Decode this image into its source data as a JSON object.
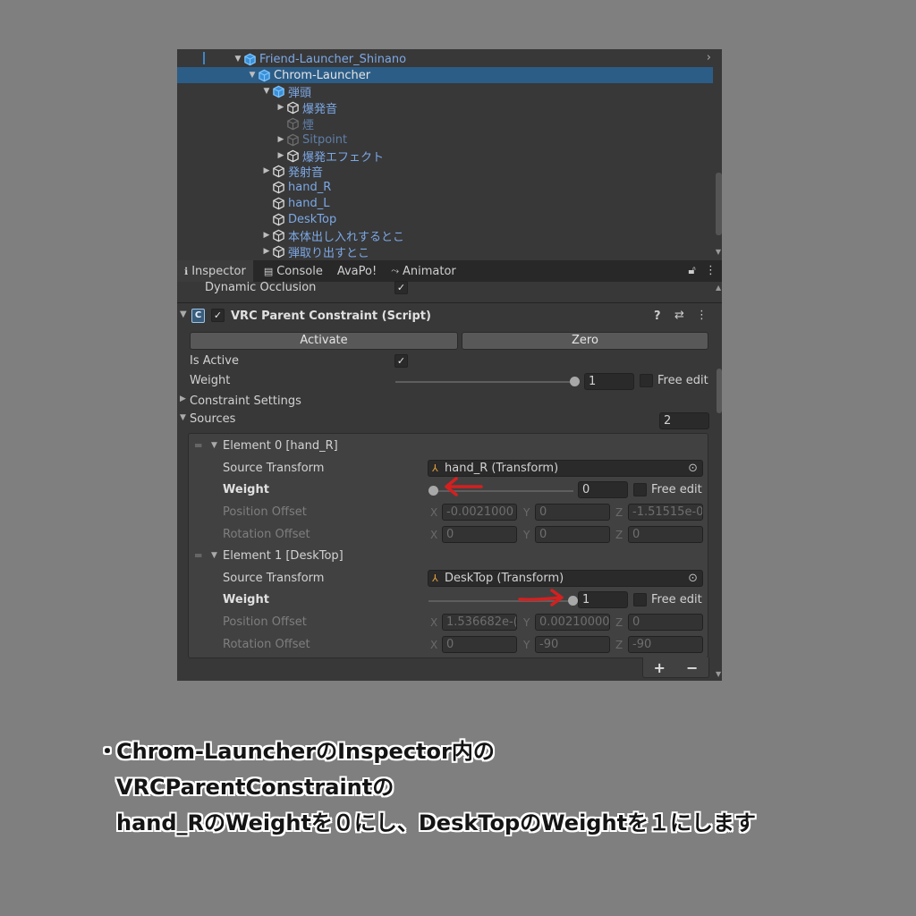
{
  "hierarchy": {
    "items": [
      {
        "label": "Friend-Launcher_Shinano",
        "indent": 0,
        "fold": "▼",
        "style": "blue",
        "prefab": true
      },
      {
        "label": "Chrom-Launcher",
        "indent": 1,
        "fold": "▼",
        "style": "white",
        "selected": true,
        "prefab": true
      },
      {
        "label": "弾頭",
        "indent": 2,
        "fold": "▼",
        "style": "blue",
        "prefab": true
      },
      {
        "label": "爆発音",
        "indent": 3,
        "fold": "▶",
        "style": "blue"
      },
      {
        "label": "煙",
        "indent": 3,
        "fold": "",
        "style": "dim"
      },
      {
        "label": "Sitpoint",
        "indent": 3,
        "fold": "▶",
        "style": "dim"
      },
      {
        "label": "爆発エフェクト",
        "indent": 3,
        "fold": "▶",
        "style": "blue"
      },
      {
        "label": "発射音",
        "indent": 2,
        "fold": "▶",
        "style": "blue"
      },
      {
        "label": "hand_R",
        "indent": 2,
        "fold": "",
        "style": "blue"
      },
      {
        "label": "hand_L",
        "indent": 2,
        "fold": "",
        "style": "blue"
      },
      {
        "label": "DeskTop",
        "indent": 2,
        "fold": "",
        "style": "blue"
      },
      {
        "label": "本体出し入れするとこ",
        "indent": 2,
        "fold": "▶",
        "style": "blue"
      },
      {
        "label": "弾取り出すとこ",
        "indent": 2,
        "fold": "▶",
        "style": "blue"
      }
    ]
  },
  "tabs": [
    {
      "label": "Inspector",
      "icon": "info-icon",
      "glyph": "ℹ"
    },
    {
      "label": "Console",
      "icon": "console-icon",
      "glyph": "▤"
    },
    {
      "label": "AvaPo!",
      "icon": "",
      "glyph": ""
    },
    {
      "label": "Animator",
      "icon": "animator-icon",
      "glyph": "⤳"
    }
  ],
  "inspector": {
    "dynamic_occlusion_label": "Dynamic Occlusion",
    "component_title": "VRC Parent Constraint (Script)",
    "activate_label": "Activate",
    "zero_label": "Zero",
    "is_active_label": "Is Active",
    "weight_label": "Weight",
    "weight_value": "1",
    "free_edit_label": "Free edit",
    "constraint_settings_label": "Constraint Settings",
    "sources_label": "Sources",
    "sources_count": "2",
    "elements": [
      {
        "header": "Element 0 [hand_R]",
        "source_transform_label": "Source Transform",
        "source_transform_value": "hand_R (Transform)",
        "weight_label": "Weight",
        "weight_value": "0",
        "weight_fraction": 0,
        "free_edit_label": "Free edit",
        "position_offset_label": "Position Offset",
        "position": {
          "x": "-0.0021000",
          "y": "0",
          "z": "-1.51515e-0"
        },
        "rotation_offset_label": "Rotation Offset",
        "rotation": {
          "x": "0",
          "y": "0",
          "z": "0"
        }
      },
      {
        "header": "Element 1 [DeskTop]",
        "source_transform_label": "Source Transform",
        "source_transform_value": "DeskTop (Transform)",
        "weight_label": "Weight",
        "weight_value": "1",
        "weight_fraction": 1,
        "free_edit_label": "Free edit",
        "position_offset_label": "Position Offset",
        "position": {
          "x": "1.536682e-(",
          "y": "0.00210000",
          "z": "0"
        },
        "rotation_offset_label": "Rotation Offset",
        "rotation": {
          "x": "0",
          "y": "-90",
          "z": "-90"
        }
      }
    ],
    "axis_x": "X",
    "axis_y": "Y",
    "axis_z": "Z",
    "add_label": "+",
    "remove_label": "−"
  },
  "annotation_color": "#d42020",
  "caption": {
    "bullet": "・",
    "line1": "Chrom-LauncherのInspector内の",
    "line2": "VRCParentConstraintの",
    "line3": "hand_RのWeightを０にし、DeskTopのWeightを１にします"
  }
}
